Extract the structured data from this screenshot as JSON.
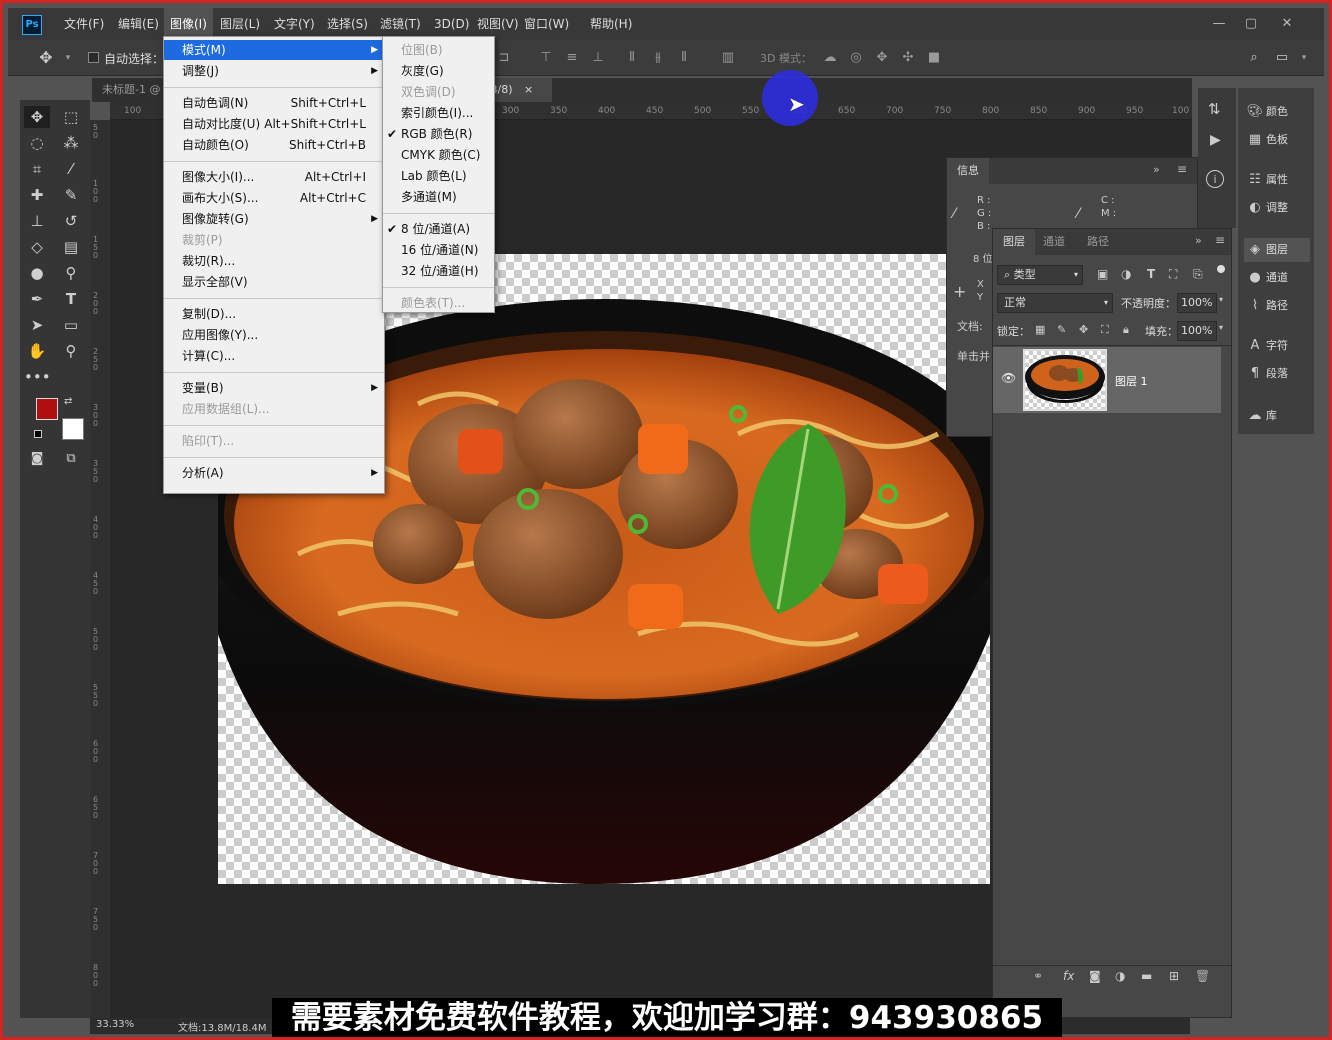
{
  "menubar": {
    "logo": "Ps",
    "items": [
      "文件(F)",
      "编辑(E)",
      "图像(I)",
      "图层(L)",
      "文字(Y)",
      "选择(S)",
      "滤镜(T)",
      "3D(D)",
      "视图(V)",
      "窗口(W)",
      "帮助(H)"
    ],
    "active_index": 2
  },
  "window_controls": {
    "minimize": "—",
    "restore": "▢",
    "close": "✕"
  },
  "options_bar": {
    "auto_select_label": "自动选择：",
    "mode_3d_label": "3D 模式："
  },
  "doc_tab": {
    "title": "未标题-1 @",
    "title_suffix": "B/8)",
    "close": "×"
  },
  "ruler_top": [
    "100",
    "300",
    "350",
    "400",
    "450",
    "500",
    "550",
    "600",
    "650",
    "700",
    "750",
    "800",
    "850",
    "900",
    "950",
    "100"
  ],
  "ruler_left": [
    "5 0",
    "1 0 0",
    "1 5 0",
    "2 0 0",
    "2 5 0",
    "3 0 0",
    "3 5 0",
    "4 0 0",
    "4 5 0",
    "5 0 0",
    "5 5 0",
    "6 0 0",
    "6 5 0",
    "7 0 0",
    "7 5 0",
    "8 0 0"
  ],
  "image_menu": {
    "items": [
      {
        "label": "模式(M)",
        "submenu": true,
        "highlight": true
      },
      {
        "label": "调整(J)",
        "submenu": true
      },
      {
        "sep": true
      },
      {
        "label": "自动色调(N)",
        "shortcut": "Shift+Ctrl+L"
      },
      {
        "label": "自动对比度(U)",
        "shortcut": "Alt+Shift+Ctrl+L"
      },
      {
        "label": "自动颜色(O)",
        "shortcut": "Shift+Ctrl+B"
      },
      {
        "sep": true
      },
      {
        "label": "图像大小(I)...",
        "shortcut": "Alt+Ctrl+I"
      },
      {
        "label": "画布大小(S)...",
        "shortcut": "Alt+Ctrl+C"
      },
      {
        "label": "图像旋转(G)",
        "submenu": true
      },
      {
        "label": "裁剪(P)",
        "disabled": true
      },
      {
        "label": "裁切(R)..."
      },
      {
        "label": "显示全部(V)"
      },
      {
        "sep": true
      },
      {
        "label": "复制(D)..."
      },
      {
        "label": "应用图像(Y)..."
      },
      {
        "label": "计算(C)..."
      },
      {
        "sep": true
      },
      {
        "label": "变量(B)",
        "submenu": true
      },
      {
        "label": "应用数据组(L)...",
        "disabled": true
      },
      {
        "sep": true
      },
      {
        "label": "陷印(T)...",
        "disabled": true
      },
      {
        "sep": true
      },
      {
        "label": "分析(A)",
        "submenu": true
      }
    ]
  },
  "mode_submenu": {
    "items": [
      {
        "label": "位图(B)",
        "disabled": true
      },
      {
        "label": "灰度(G)"
      },
      {
        "label": "双色调(D)",
        "disabled": true
      },
      {
        "label": "索引颜色(I)..."
      },
      {
        "label": "RGB 颜色(R)",
        "checked": true
      },
      {
        "label": "CMYK 颜色(C)"
      },
      {
        "label": "Lab 颜色(L)"
      },
      {
        "label": "多通道(M)"
      },
      {
        "sep": true
      },
      {
        "label": "8 位/通道(A)",
        "checked": true
      },
      {
        "label": "16 位/通道(N)"
      },
      {
        "label": "32 位/通道(H)"
      },
      {
        "sep": true
      },
      {
        "label": "颜色表(T)...",
        "disabled": true
      }
    ]
  },
  "check_glyph": "✔",
  "arrow_glyph": "▶",
  "info_panel": {
    "title": "信息",
    "rgb_labels": "R :\nG :\nB :",
    "cmyk_labels": "C :\nM :",
    "bits": "8 位",
    "xy": "X\nY",
    "doc_label": "文档:",
    "hint": "单击并"
  },
  "layers_panel": {
    "tabs": [
      "图层",
      "通道",
      "路径"
    ],
    "filter_label": "类型",
    "blend_mode": "正常",
    "opacity_label": "不透明度：",
    "opacity_value": "100%",
    "lock_label": "锁定：",
    "fill_label": "填充：",
    "fill_value": "100%",
    "layers": [
      {
        "name": "图层 1",
        "visible": true
      }
    ],
    "bottom_icons": [
      "link-icon",
      "fx-icon",
      "mask-icon",
      "adjustment-icon",
      "folder-icon",
      "new-layer-icon",
      "trash-icon"
    ],
    "fx_text": "fx"
  },
  "right_strip": {
    "items": [
      {
        "label": "颜色",
        "icon": "palette-icon"
      },
      {
        "label": "色板",
        "icon": "swatches-icon"
      },
      {
        "label": "属性",
        "icon": "properties-icon"
      },
      {
        "label": "调整",
        "icon": "adjustments-icon"
      },
      {
        "label": "图层",
        "icon": "layers-icon",
        "active": true
      },
      {
        "label": "通道",
        "icon": "channels-icon"
      },
      {
        "label": "路径",
        "icon": "paths-icon"
      },
      {
        "label": "字符",
        "icon": "character-icon"
      },
      {
        "label": "段落",
        "icon": "paragraph-icon"
      },
      {
        "label": "库",
        "icon": "library-icon"
      }
    ]
  },
  "status": {
    "zoom": "33.33%",
    "doc_size": "文档:13.8M/18.4M"
  },
  "caption": "需要素材免费软件教程，欢迎加学习群：943930865",
  "colors": {
    "foreground": "#b01010",
    "background": "#ffffff",
    "highlight": "#1e6ae0",
    "cursor_glow": "#2d2de0"
  }
}
